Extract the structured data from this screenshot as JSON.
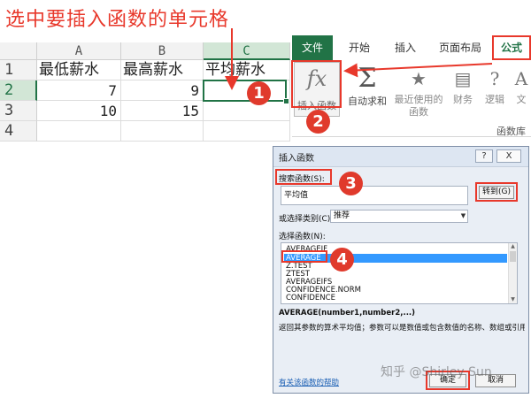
{
  "caption": "选中要插入函数的单元格",
  "sheet": {
    "columns": [
      "A",
      "B",
      "C"
    ],
    "rows": [
      "1",
      "2",
      "3",
      "4"
    ],
    "cells": {
      "A1": "最低薪水",
      "B1": "最高薪水",
      "C1": "平均薪水",
      "A2": "7",
      "B2": "9",
      "C2": "",
      "A3": "10",
      "B3": "15",
      "C3": ""
    },
    "selected_cell": "C2"
  },
  "ribbon": {
    "tabs": [
      "文件",
      "开始",
      "插入",
      "页面布局",
      "公式"
    ],
    "active_tab": "公式",
    "buttons": {
      "insert_function": "插入函数",
      "autosum": "自动求和",
      "recent_line1": "最近使用的",
      "recent_line2": "函数",
      "financial": "财务",
      "logical": "逻辑",
      "text": "文"
    },
    "group_label": "函数库"
  },
  "dialog": {
    "title": "插入函数",
    "help_btn": "?",
    "close_btn": "X",
    "search_label": "搜索函数(S):",
    "search_value": "平均值",
    "goto_btn": "转到(G)",
    "category_label": "或选择类别(C):",
    "category_value": "推荐",
    "list_label": "选择函数(N):",
    "functions": [
      "AVERAGEIF",
      "AVERAGE",
      "Z.TEST",
      "ZTEST",
      "AVERAGEIFS",
      "CONFIDENCE.NORM",
      "CONFIDENCE"
    ],
    "selected_function": "AVERAGE",
    "signature": "AVERAGE(number1,number2,...)",
    "description": "返回其参数的算术平均值；参数可以是数值或包含数值的名称、数组或引用",
    "help_link": "有关该函数的帮助",
    "ok_btn": "确定",
    "cancel_btn": "取消"
  },
  "annotations": {
    "step1": "1",
    "step2": "2",
    "step3": "3",
    "step4": "4"
  },
  "watermark": "知乎 @Shirley Sun",
  "colors": {
    "annotation_red": "#e8382b",
    "excel_green": "#217346",
    "selection_blue": "#3399ff"
  }
}
